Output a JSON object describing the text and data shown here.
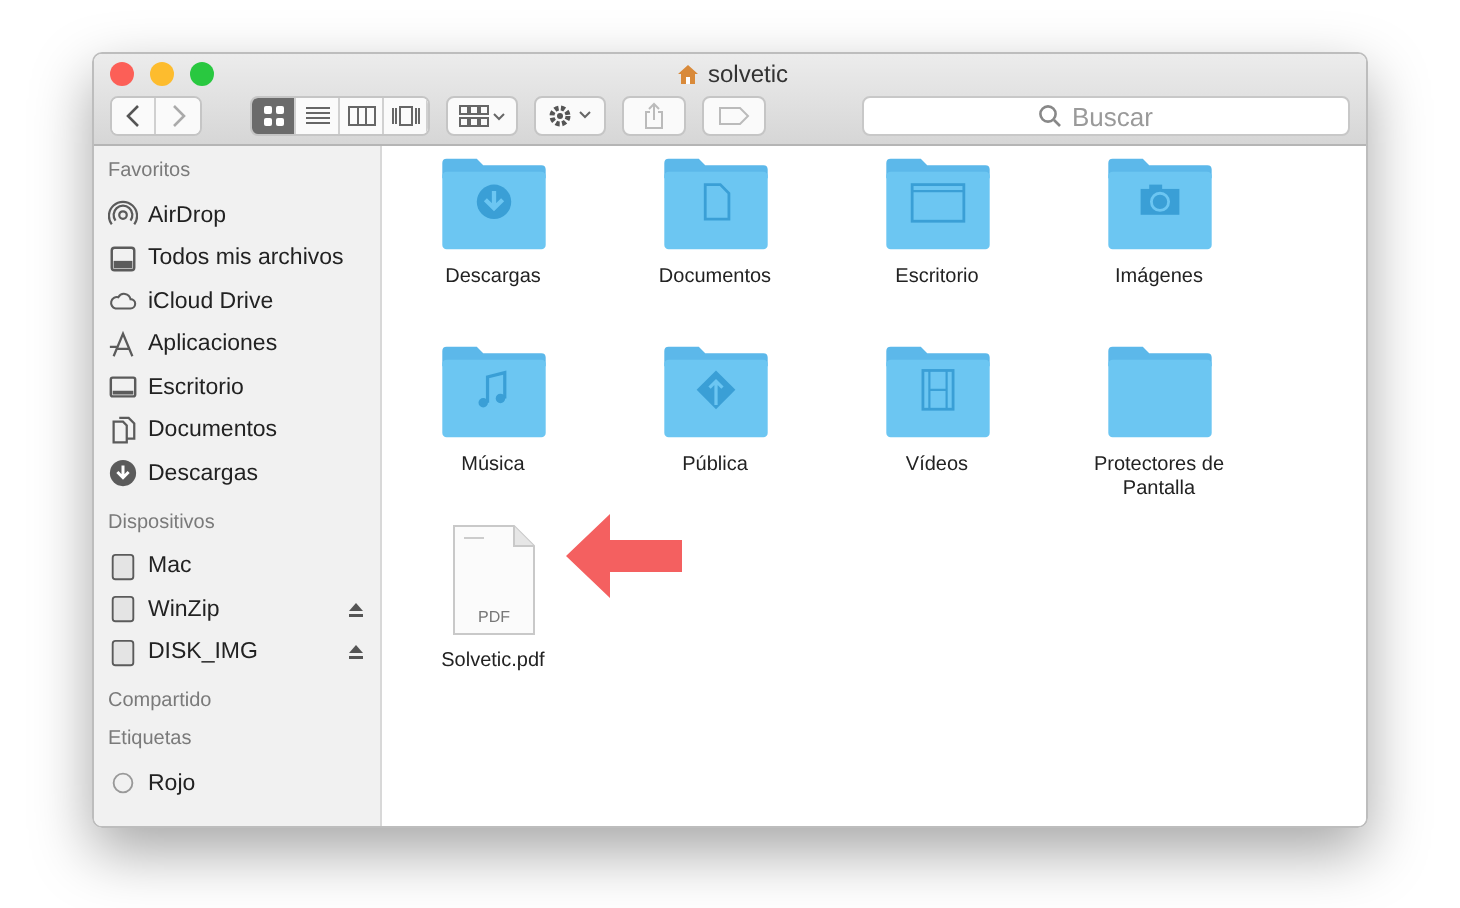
{
  "window": {
    "title": "solvetic"
  },
  "toolbar": {
    "view_modes": [
      {
        "kind": "icons",
        "selected": true
      },
      {
        "kind": "list",
        "selected": false
      },
      {
        "kind": "columns",
        "selected": false
      },
      {
        "kind": "coverflow",
        "selected": false
      }
    ],
    "search": {
      "placeholder": "Buscar"
    }
  },
  "sidebar": {
    "sections": [
      {
        "heading": "Favoritos",
        "items": [
          {
            "label": "AirDrop",
            "kind": "airdrop"
          },
          {
            "label": "Todos mis archivos",
            "kind": "files"
          },
          {
            "label": "iCloud Drive",
            "kind": "cloud"
          },
          {
            "label": "Aplicaciones",
            "kind": "apps"
          },
          {
            "label": "Escritorio",
            "kind": "desktop"
          },
          {
            "label": "Documentos",
            "kind": "documents"
          },
          {
            "label": "Descargas",
            "kind": "downloads"
          }
        ]
      },
      {
        "heading": "Dispositivos",
        "items": [
          {
            "label": "Mac",
            "kind": "disk",
            "ejectable": false
          },
          {
            "label": "WinZip",
            "kind": "disk",
            "ejectable": true
          },
          {
            "label": "DISK_IMG",
            "kind": "disk",
            "ejectable": true
          }
        ]
      },
      {
        "heading": "Compartido"
      },
      {
        "heading": "Etiquetas",
        "items": [
          {
            "label": "Rojo",
            "kind": "tag"
          }
        ]
      }
    ]
  },
  "files": [
    {
      "name": "Descargas",
      "kind": "download"
    },
    {
      "name": "Documentos",
      "kind": "document"
    },
    {
      "name": "Escritorio",
      "kind": "desktop"
    },
    {
      "name": "Imágenes",
      "kind": "camera"
    },
    {
      "name": "Música",
      "kind": "music"
    },
    {
      "name": "Pública",
      "kind": "public"
    },
    {
      "name": "Vídeos",
      "kind": "film"
    },
    {
      "name": "Protectores de Pantalla",
      "kind": "plain"
    },
    {
      "name": "Solvetic.pdf",
      "kind": "pdf",
      "badge": "PDF"
    }
  ]
}
